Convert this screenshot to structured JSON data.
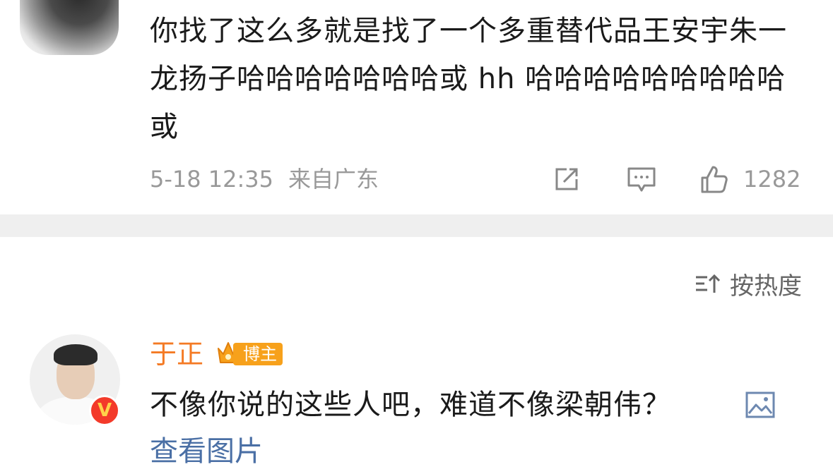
{
  "comment1": {
    "text": "你找了这么多就是找了一个多重替代品王安宇朱一龙扬子哈哈哈哈哈哈哈或 hh 哈哈哈哈哈哈哈哈哈或",
    "time": "5-18 12:35",
    "location": "来自广东",
    "like_count": "1282"
  },
  "sort": {
    "label": "按热度"
  },
  "comment2": {
    "username": "于正",
    "badge": "博主",
    "text": "不像你说的这些人吧，难道不像梁朝伟？",
    "view_pictures": "查看图片",
    "verified_mark": "V"
  },
  "colors": {
    "username": "#f47a24",
    "badge": "#f7a11b",
    "link": "#4a6fa5",
    "meta": "#999999",
    "divider": "#efefef"
  },
  "icons": [
    "share-icon",
    "comment-icon",
    "like-icon",
    "sort-icon",
    "picture-icon",
    "crown-icon",
    "verified-icon"
  ]
}
